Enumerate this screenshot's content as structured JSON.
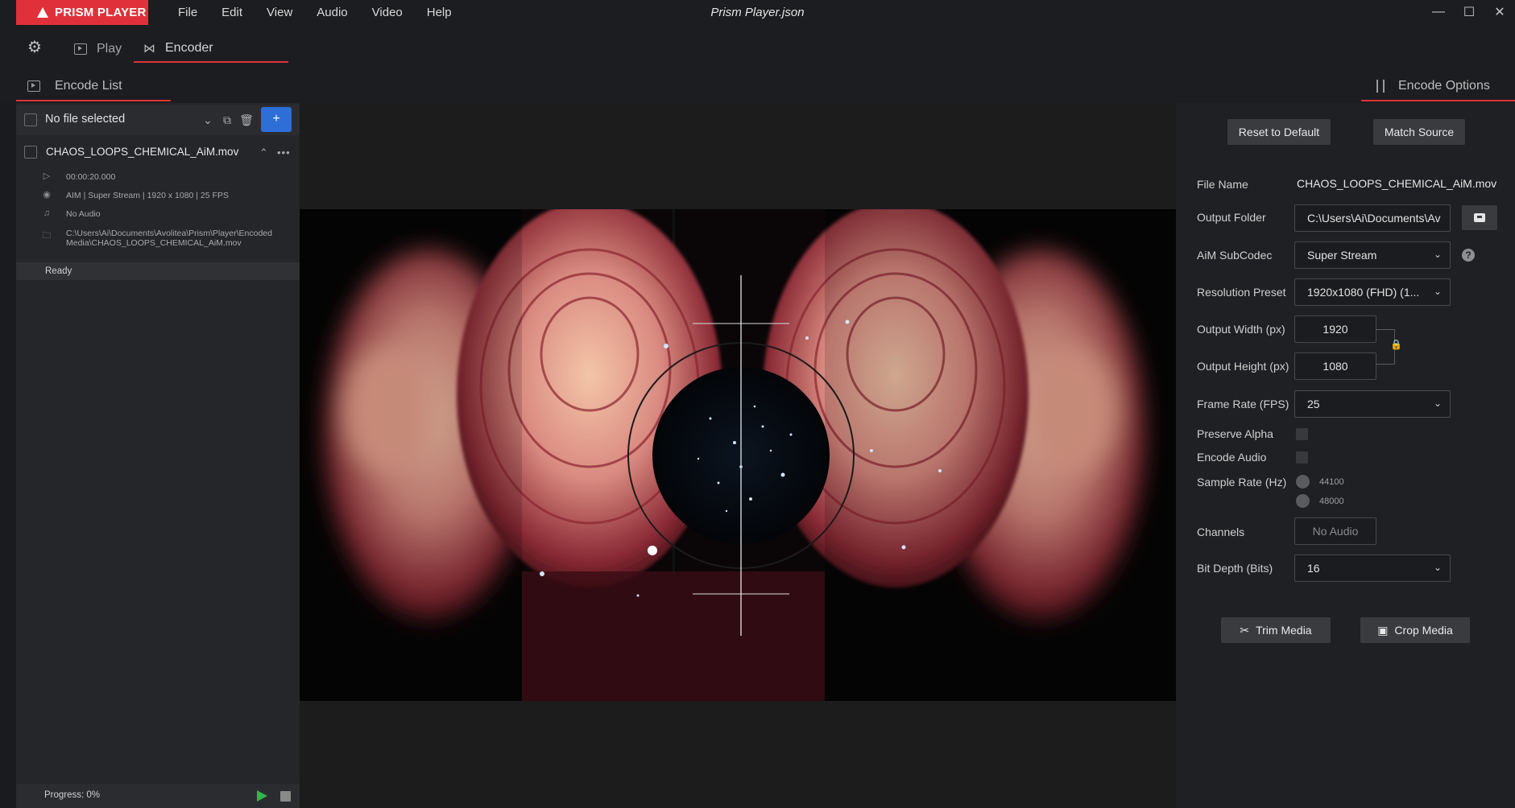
{
  "app": {
    "brand": "PRISM PLAYER",
    "window_title": "Prism Player.json",
    "menu": [
      "File",
      "Edit",
      "View",
      "Audio",
      "Video",
      "Help"
    ]
  },
  "modes": {
    "play": "Play",
    "encoder": "Encoder"
  },
  "sections": {
    "encode_list": "Encode List",
    "encode_options": "Encode Options"
  },
  "encode_list": {
    "no_file": "No file selected",
    "item": {
      "name": "CHAOS_LOOPS_CHEMICAL_AiM.mov",
      "duration": "00:00:20.000",
      "video": "AIM | Super Stream | 1920 x 1080 | 25 FPS",
      "audio": "No Audio",
      "path_line1": "C:\\Users\\Ai\\Documents\\Avolitea\\Prism\\Player\\Encoded",
      "path_line2": "Media\\CHAOS_LOOPS_CHEMICAL_AiM.mov",
      "status": "Ready"
    },
    "progress": "Progress: 0%"
  },
  "options": {
    "reset": "Reset to Default",
    "match": "Match Source",
    "file_name_label": "File Name",
    "file_name": "CHAOS_LOOPS_CHEMICAL_AiM.mov",
    "output_folder_label": "Output Folder",
    "output_folder": "C:\\Users\\Ai\\Documents\\Av",
    "subcodec_label": "AiM SubCodec",
    "subcodec": "Super Stream",
    "resolution_label": "Resolution Preset",
    "resolution": "1920x1080 (FHD) (1...",
    "width_label": "Output Width (px)",
    "width": "1920",
    "height_label": "Output Height (px)",
    "height": "1080",
    "framerate_label": "Frame Rate (FPS)",
    "framerate": "25",
    "alpha_label": "Preserve Alpha",
    "audio_label": "Encode Audio",
    "samplerate_label": "Sample Rate (Hz)",
    "samplerates": [
      "44100",
      "48000"
    ],
    "channels_label": "Channels",
    "channels_placeholder": "No Audio",
    "bitdepth_label": "Bit Depth (Bits)",
    "bitdepth": "16",
    "trim": "Trim Media",
    "crop": "Crop Media"
  }
}
